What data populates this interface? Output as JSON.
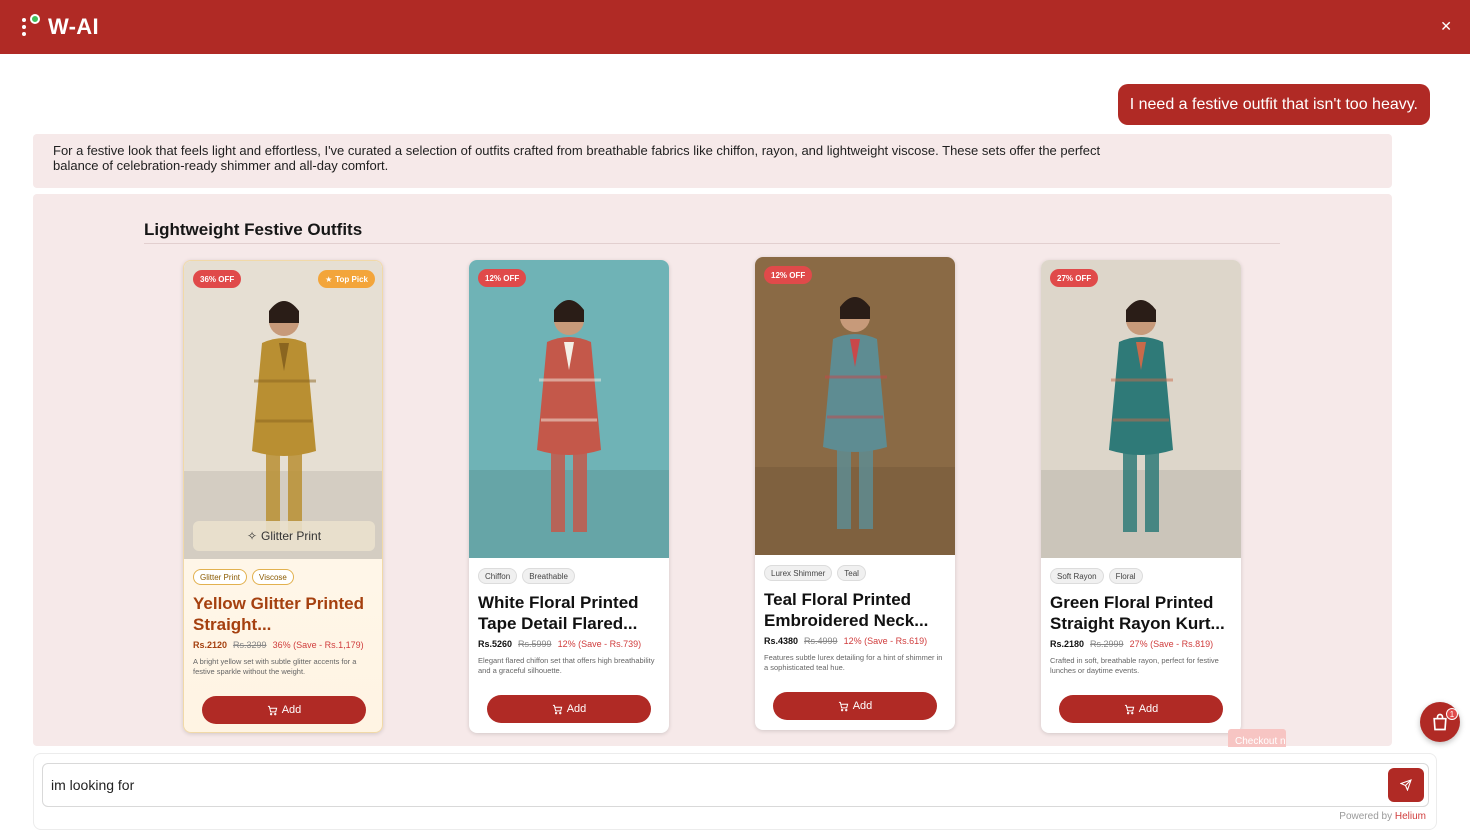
{
  "app": {
    "logo_text": "W-AI"
  },
  "chat": {
    "user_message": "I need a festive outfit that isn't too heavy.",
    "assistant_message": "For a festive look that feels light and effortless, I've curated a selection of outfits crafted from breathable fabrics like chiffon, rayon, and lightweight viscose. These sets offer the perfect balance of celebration-ready shimmer and all-day comfort."
  },
  "collection": {
    "title": "Lightweight Festive Outfits",
    "add_label": "Add",
    "products": [
      {
        "name": "Yellow Glitter Printed Straight...",
        "discount_badge": "36% OFF",
        "top_pick": "Top Pick",
        "feature_chip": "Glitter Print",
        "tags": [
          "Glitter Print",
          "Viscose"
        ],
        "price": "Rs.2120",
        "mrp": "Rs.3299",
        "discount_text": "36% (Save - Rs.1,179)",
        "description": "A bright yellow set with subtle glitter accents for a festive sparkle without the weight.",
        "colors": {
          "bg": "#e6dfd3",
          "dress": "#b98f32",
          "accent": "#8a6520"
        }
      },
      {
        "name": "White Floral Printed Tape Detail Flared...",
        "discount_badge": "12% OFF",
        "tags": [
          "Chiffon",
          "Breathable"
        ],
        "price": "Rs.5260",
        "mrp": "Rs.5999",
        "discount_text": "12% (Save - Rs.739)",
        "description": "Elegant flared chiffon set that offers high breathability and a graceful silhouette.",
        "colors": {
          "bg": "#6fb3b6",
          "dress": "#c4584a",
          "accent": "#f4efe6"
        }
      },
      {
        "name": "Teal Floral Printed Embroidered Neck...",
        "discount_badge": "12% OFF",
        "tags": [
          "Lurex Shimmer",
          "Teal"
        ],
        "price": "Rs.4380",
        "mrp": "Rs.4999",
        "discount_text": "12% (Save - Rs.619)",
        "description": "Features subtle lurex detailing for a hint of shimmer in a sophisticated teal hue.",
        "colors": {
          "bg": "#8a6a45",
          "dress": "#5e8c92",
          "accent": "#c9484a"
        }
      },
      {
        "name": "Green Floral Printed Straight Rayon Kurt...",
        "discount_badge": "27% OFF",
        "tags": [
          "Soft Rayon",
          "Floral"
        ],
        "price": "Rs.2180",
        "mrp": "Rs.2999",
        "discount_text": "27% (Save - Rs.819)",
        "description": "Crafted in soft, breathable rayon, perfect for festive lunches or daytime events.",
        "colors": {
          "bg": "#ddd6ca",
          "dress": "#2f7a78",
          "accent": "#c96a4a"
        }
      }
    ]
  },
  "checkout_label": "Checkout n",
  "cart": {
    "count": "1"
  },
  "composer": {
    "value": "im looking for",
    "powered_prefix": "Powered by",
    "powered_brand": "Helium"
  },
  "theme": {
    "primary": "#b02a25",
    "panel_bg": "#f6e9e9"
  }
}
